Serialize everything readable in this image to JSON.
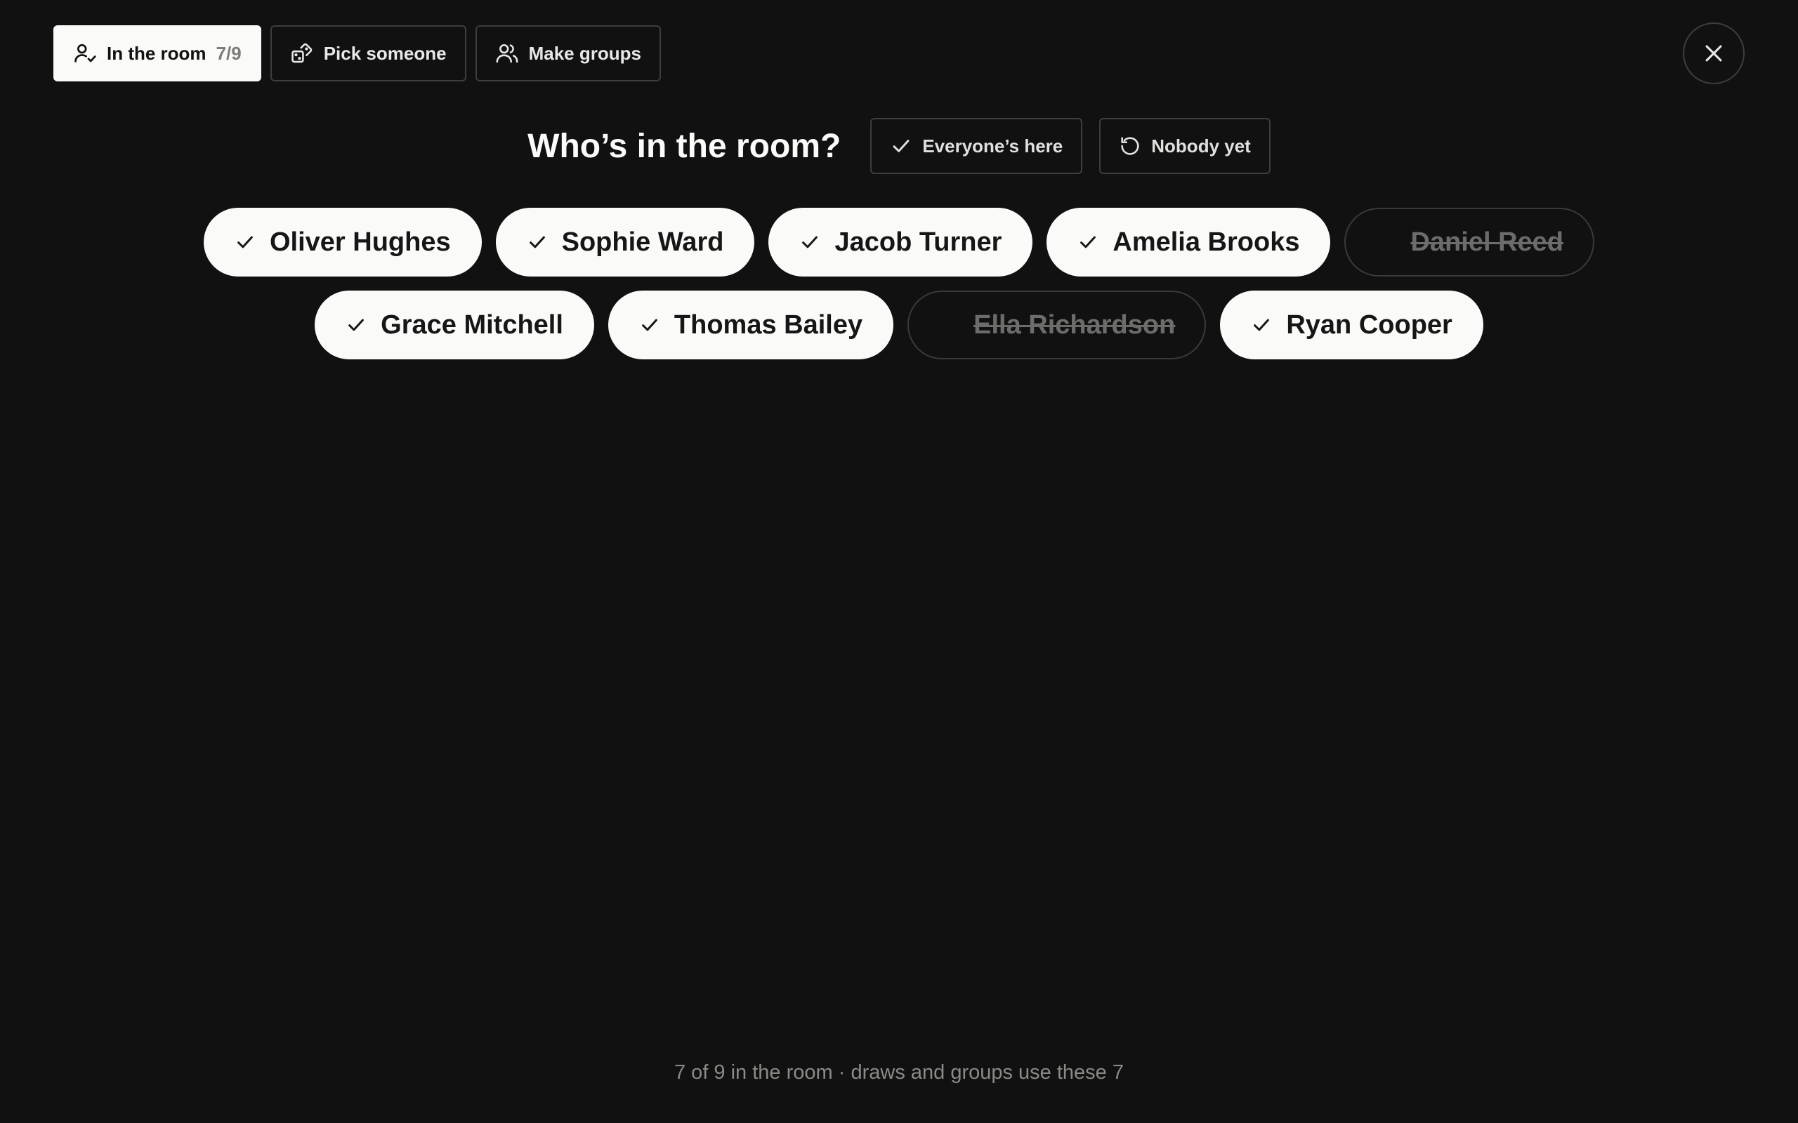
{
  "tabs": [
    {
      "label": "In the room",
      "count": "7/9",
      "icon": "user-check-icon",
      "active": true
    },
    {
      "label": "Pick someone",
      "icon": "dice-icon",
      "active": false
    },
    {
      "label": "Make groups",
      "icon": "users-icon",
      "active": false
    }
  ],
  "close_icon": "close-icon",
  "heading": "Who’s in the room?",
  "actions": {
    "everyone": {
      "label": "Everyone’s here",
      "icon": "check-icon"
    },
    "nobody": {
      "label": "Nobody yet",
      "icon": "reset-icon"
    }
  },
  "people": [
    {
      "name": "Oliver Hughes",
      "present": true
    },
    {
      "name": "Sophie Ward",
      "present": true
    },
    {
      "name": "Jacob Turner",
      "present": true
    },
    {
      "name": "Amelia Brooks",
      "present": true
    },
    {
      "name": "Daniel Reed",
      "present": false
    },
    {
      "name": "Grace Mitchell",
      "present": true
    },
    {
      "name": "Thomas Bailey",
      "present": true
    },
    {
      "name": "Ella Richardson",
      "present": false
    },
    {
      "name": "Ryan Cooper",
      "present": true
    }
  ],
  "footer": "7 of 9 in the room · draws and groups use these 7",
  "colors": {
    "background": "#111111",
    "chip_present": "#fafaf8",
    "chip_absent_text": "#6c6c6a",
    "border": "#3e3e3e",
    "muted": "#8a8a86"
  }
}
